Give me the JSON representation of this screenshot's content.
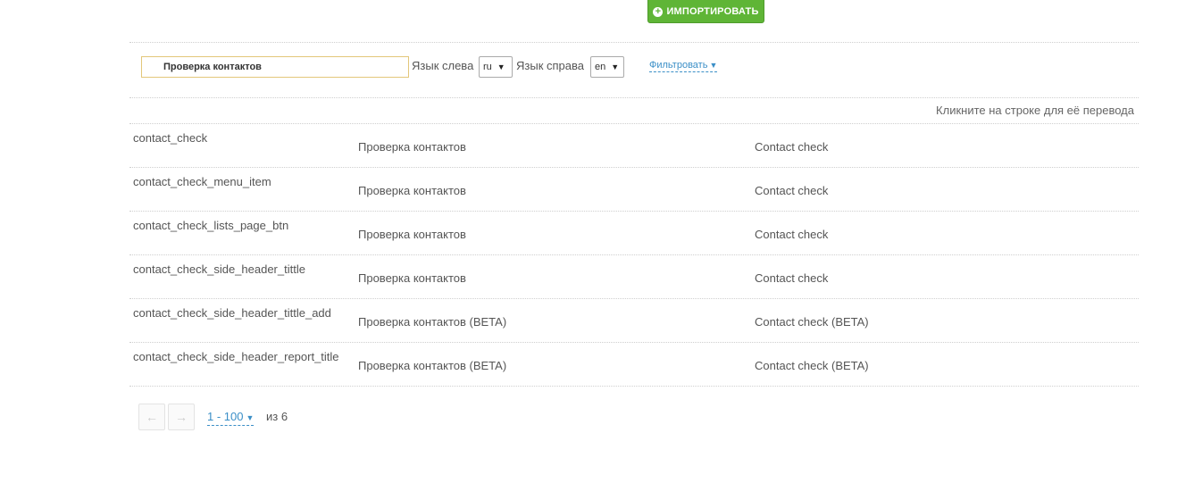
{
  "toolbar": {
    "import_label": "ИМПОРТИРОВАТЬ",
    "import_icon": "plus-circle-icon"
  },
  "filters": {
    "search_value": "Проверка контактов",
    "lang_left_label": "Язык слева",
    "lang_left_value": "ru",
    "lang_right_label": "Язык справа",
    "lang_right_value": "en",
    "filter_label": "Фильтровать"
  },
  "table": {
    "hint": "Кликните на строке для её перевода",
    "rows": [
      {
        "key": "contact_check",
        "ru": "Проверка контактов",
        "en": "Contact check"
      },
      {
        "key": "contact_check_menu_item",
        "ru": "Проверка контактов",
        "en": "Contact check"
      },
      {
        "key": "contact_check_lists_page_btn",
        "ru": "Проверка контактов",
        "en": "Contact check"
      },
      {
        "key": "contact_check_side_header_tittle",
        "ru": "Проверка контактов",
        "en": "Contact check"
      },
      {
        "key": "contact_check_side_header_tittle_add",
        "ru": "Проверка контактов (BETA)",
        "en": "Contact check (BETA)"
      },
      {
        "key": "contact_check_side_header_report_title",
        "ru": "Проверка контактов (BETA)",
        "en": "Contact check (BETA)"
      }
    ]
  },
  "pagination": {
    "range": "1 - 100",
    "of": "из 6"
  },
  "colors": {
    "accent_green": "#5fb536",
    "link_blue": "#3b8fc7",
    "search_border": "#e3c77a"
  }
}
